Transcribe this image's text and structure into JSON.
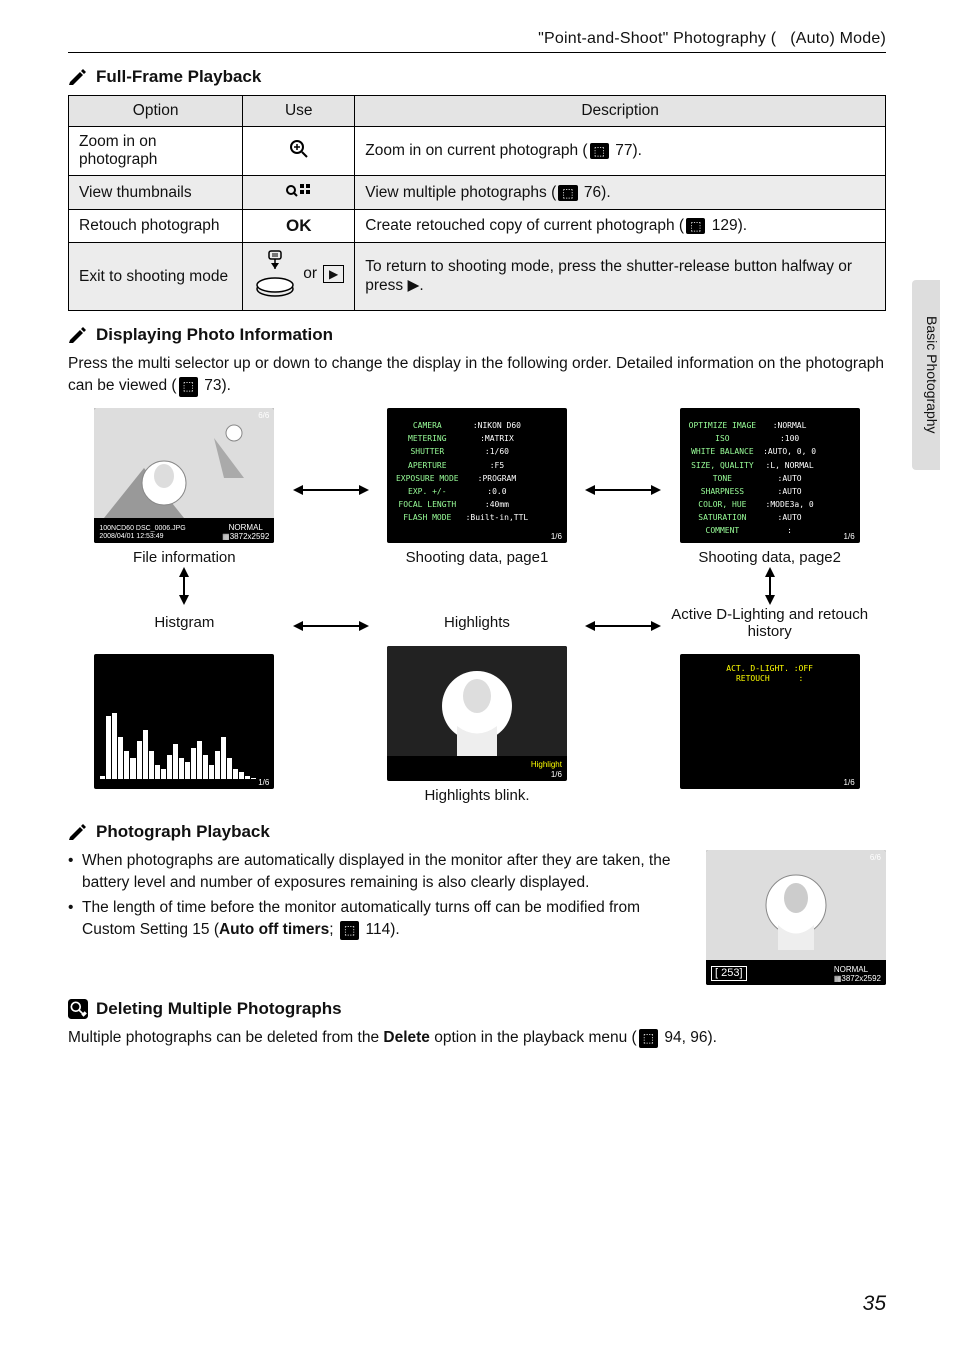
{
  "breadcrumb": "\"Point-and-Shoot\" Photography (   (Auto) Mode)",
  "sidebar_label": "Basic Photography",
  "page_number": "35",
  "section1": {
    "title": "Full-Frame Playback",
    "headers": {
      "option": "Option",
      "use": "Use",
      "description": "Description"
    },
    "rows": [
      {
        "option": "Zoom in on photograph",
        "desc_pre": "Zoom in on current photograph (",
        "ref": "77",
        "desc_post": ")."
      },
      {
        "option": "View thumbnails",
        "desc_pre": "View multiple photographs (",
        "ref": "76",
        "desc_post": ")."
      },
      {
        "option": "Retouch photograph",
        "use": "OK",
        "desc_pre": "Create retouched copy of current photograph (",
        "ref": "129",
        "desc_post": ")."
      },
      {
        "option": "Exit to shooting mode",
        "or": "or",
        "desc": "To return to shooting mode, press the shutter-release button halfway or press ▶."
      }
    ]
  },
  "section2": {
    "title": "Displaying Photo Information",
    "body_pre": "Press the multi selector up or down to change the display in the following order. Detailed information on the photograph can be viewed (",
    "body_ref": "73",
    "body_post": ").",
    "labels": {
      "file_info": "File information",
      "shoot1": "Shooting data, page1",
      "shoot2": "Shooting data, page2",
      "histogram": "Histgram",
      "highlights": "Highlights",
      "active_d": "Active D-Lighting and retouch history",
      "highlights_blink": "Highlights blink."
    },
    "screens": {
      "file_counter": "6/6",
      "file_footer_l1": "100NCD60  DSC_0006.JPG",
      "file_footer_l2": "2008/04/01 12:53:49",
      "file_footer_r": "NORMAL\n▦3872x2592",
      "shoot1_pairs": [
        [
          "CAMERA",
          ":NIKON D60"
        ],
        [
          "METERING",
          ":MATRIX"
        ],
        [
          "SHUTTER",
          ":1/60"
        ],
        [
          "APERTURE",
          ":F5"
        ],
        [
          "EXPOSURE MODE",
          ":PROGRAM"
        ],
        [
          "EXP. +/-",
          ":0.0"
        ],
        [
          "FOCAL LENGTH",
          ":40mm"
        ],
        [
          "FLASH MODE",
          ":Built-in,TTL"
        ]
      ],
      "shoot1_footer": "1/6",
      "shoot2_pairs": [
        [
          "OPTIMIZE IMAGE",
          ":NORMAL"
        ],
        [
          "ISO",
          ":100"
        ],
        [
          "WHITE BALANCE",
          ":AUTO, 0, 0"
        ],
        [
          "SIZE, QUALITY",
          ":L, NORMAL"
        ],
        [
          "TONE",
          ":AUTO"
        ],
        [
          "SHARPNESS",
          ":AUTO"
        ],
        [
          "COLOR, HUE",
          ":MODE3a, 0"
        ],
        [
          "SATURATION",
          ":AUTO"
        ],
        [
          "COMMENT",
          ":"
        ]
      ],
      "shoot2_footer": "1/6",
      "hist_footer": "1/6",
      "highlight_label": "Highlight",
      "highlight_footer": "1/6",
      "adl_text": "ACT. D-LIGHT. :OFF\nRETOUCH      :",
      "adl_footer": "1/6"
    }
  },
  "section3": {
    "title": "Photograph Playback",
    "bullets": [
      "When photographs are automatically displayed in the monitor after they are taken, the battery level and number of exposures remaining is also clearly displayed.",
      "The length of time before the monitor automatically turns off can be modified from Custom Setting 15 (Auto off timers;  114)."
    ],
    "bullet2_bold": "Auto off timers",
    "bullet2_ref": "114",
    "thumb": {
      "counter": "6/6",
      "battery_frames": "[ 253]",
      "footer": "NORMAL\n▦3872x2592"
    }
  },
  "section4": {
    "title": "Deleting Multiple Photographs",
    "body_pre": "Multiple photographs can be deleted from the ",
    "body_bold": "Delete",
    "body_mid": " option in the playback menu (",
    "body_ref": "94, 96",
    "body_post": ")."
  }
}
